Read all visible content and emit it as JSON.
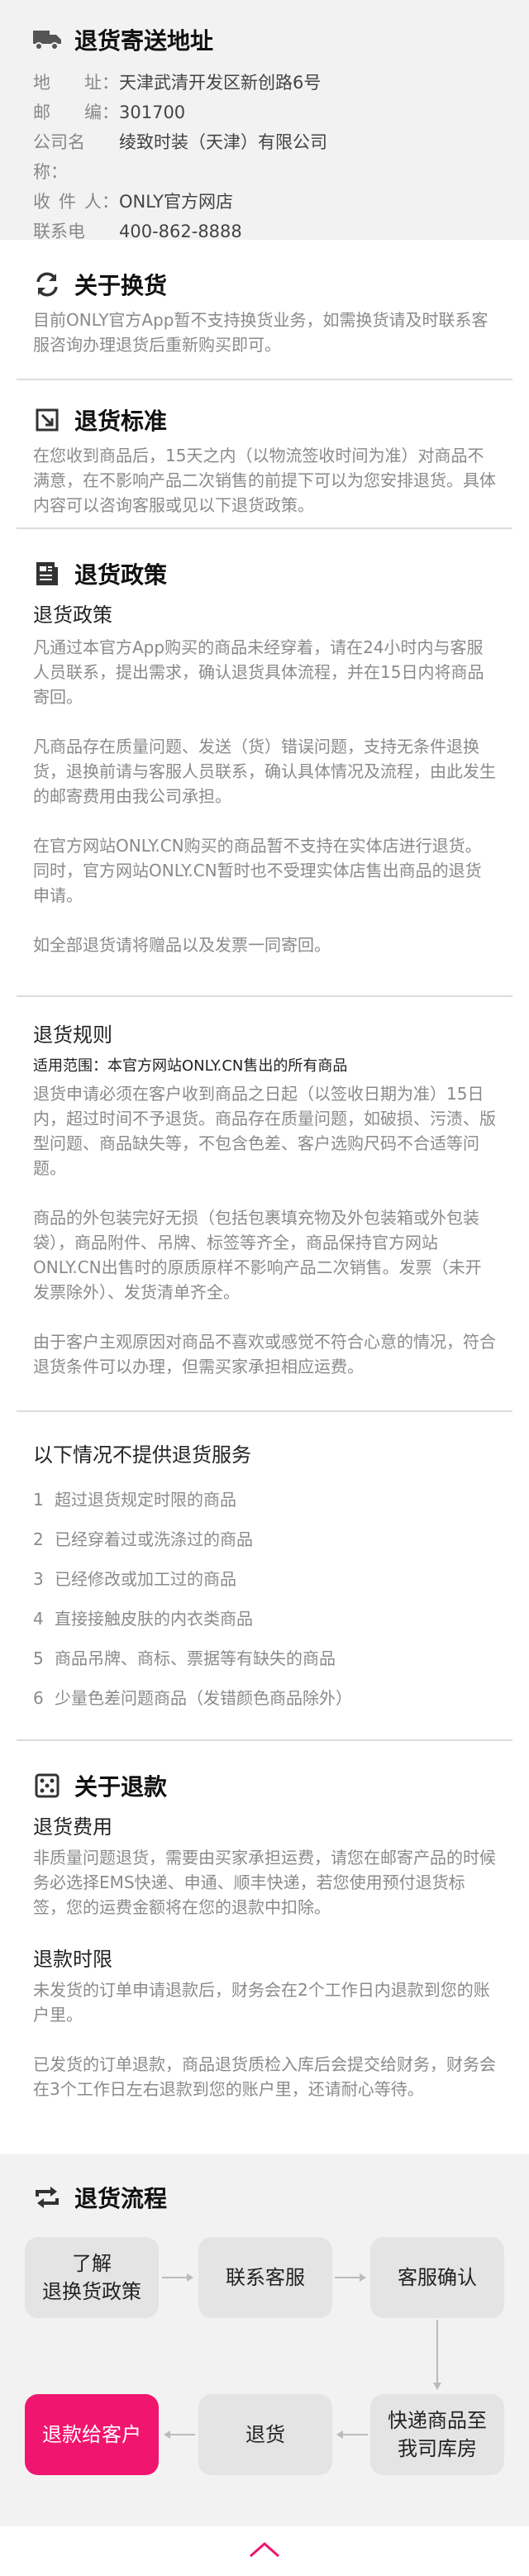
{
  "address": {
    "title": "退货寄送地址",
    "rows": [
      {
        "key": "地址",
        "value": "天津武清开发区新创路6号"
      },
      {
        "key": "邮编",
        "value": "301700"
      },
      {
        "key": "公司名称",
        "value": "绫致时装（天津）有限公司"
      },
      {
        "key": "收件人",
        "value": "ONLY官方网店"
      },
      {
        "key": "联系电话",
        "value": "400-862-8888"
      }
    ]
  },
  "exchange": {
    "title": "关于换货",
    "text": "目前ONLY官方App暂不支持换货业务，如需换货请及时联系客服咨询办理退货后重新购买即可。"
  },
  "standard": {
    "title": "退货标准",
    "text": "在您收到商品后，15天之内（以物流签收时间为准）对商品不满意，在不影响产品二次销售的前提下可以为您安排退货。具体内容可以咨询客服或见以下退货政策。"
  },
  "policy": {
    "title": "退货政策",
    "subtitle": "退货政策",
    "paragraphs": [
      "凡通过本官方App购买的商品未经穿着，请在24小时内与客服人员联系，提出需求，确认退货具体流程，并在15日内将商品寄回。",
      "凡商品存在质量问题、发送（货）错误问题，支持无条件退换货，退换前请与客服人员联系，确认具体情况及流程，由此发生的邮寄费用由我公司承担。",
      "在官方网站ONLY.CN购买的商品暂不支持在实体店进行退货。同时，官方网站ONLY.CN暂时也不受理实体店售出商品的退货申请。",
      "如全部退货请将赠品以及发票一同寄回。"
    ]
  },
  "rules": {
    "subtitle": "退货规则",
    "scope": "适用范围：本官方网站ONLY.CN售出的所有商品",
    "paragraphs": [
      "退货申请必须在客户收到商品之日起（以签收日期为准）15日内，超过时间不予退货。商品存在质量问题，如破损、污渍、版型问题、商品缺失等，不包含色差、客户选购尺码不合适等问题。",
      "商品的外包装完好无损（包括包裹填充物及外包装箱或外包装袋），商品附件、吊牌、标签等齐全，商品保持官方网站ONLY.CN出售时的原质原样不影响产品二次销售。发票（未开发票除外）、发货清单齐全。",
      "由于客户主观原因对商品不喜欢或感觉不符合心意的情况，符合退货条件可以办理，但需买家承担相应运费。"
    ]
  },
  "exclusions": {
    "title": "以下情况不提供退货服务",
    "items": [
      {
        "num": "1",
        "text": "超过退货规定时限的商品"
      },
      {
        "num": "2",
        "text": "已经穿着过或洗涤过的商品"
      },
      {
        "num": "3",
        "text": "已经修改或加工过的商品"
      },
      {
        "num": "4",
        "text": "直接接触皮肤的内衣类商品"
      },
      {
        "num": "5",
        "text": "商品吊牌、商标、票据等有缺失的商品"
      },
      {
        "num": "6",
        "text": "少量色差问题商品（发错颜色商品除外）"
      }
    ]
  },
  "refund": {
    "title": "关于退款",
    "fee_subtitle": "退货费用",
    "fee_text": "非质量问题退货，需要由买家承担运费，请您在邮寄产品的时候务必选择EMS快递、申通、顺丰快递，若您使用预付退货标签，您的运费金额将在您的退款中扣除。",
    "time_subtitle": "退款时限",
    "time_paragraphs": [
      "未发货的订单申请退款后，财务会在2个工作日内退款到您的账户里。",
      "已发货的订单退款，商品退货质检入库后会提交给财务，财务会在3个工作日左右退款到您的账户里，还请耐心等待。"
    ]
  },
  "process": {
    "title": "退货流程",
    "steps": [
      {
        "line1": "了解",
        "line2": "退换货政策"
      },
      {
        "line1": "联系客服",
        "line2": ""
      },
      {
        "line1": "客服确认",
        "line2": ""
      },
      {
        "line1": "快递商品至",
        "line2": "我司库房"
      },
      {
        "line1": "退货",
        "line2": ""
      },
      {
        "line1": "退款给客户",
        "line2": ""
      }
    ]
  },
  "colors": {
    "accent": "#f0166f",
    "box": "#e4e4e4",
    "band": "#f2f2f2"
  },
  "icons": [
    "truck-icon",
    "exchange-icon",
    "return-icon",
    "document-icon",
    "dice-icon",
    "cycle-icon",
    "chevron-up-icon"
  ]
}
